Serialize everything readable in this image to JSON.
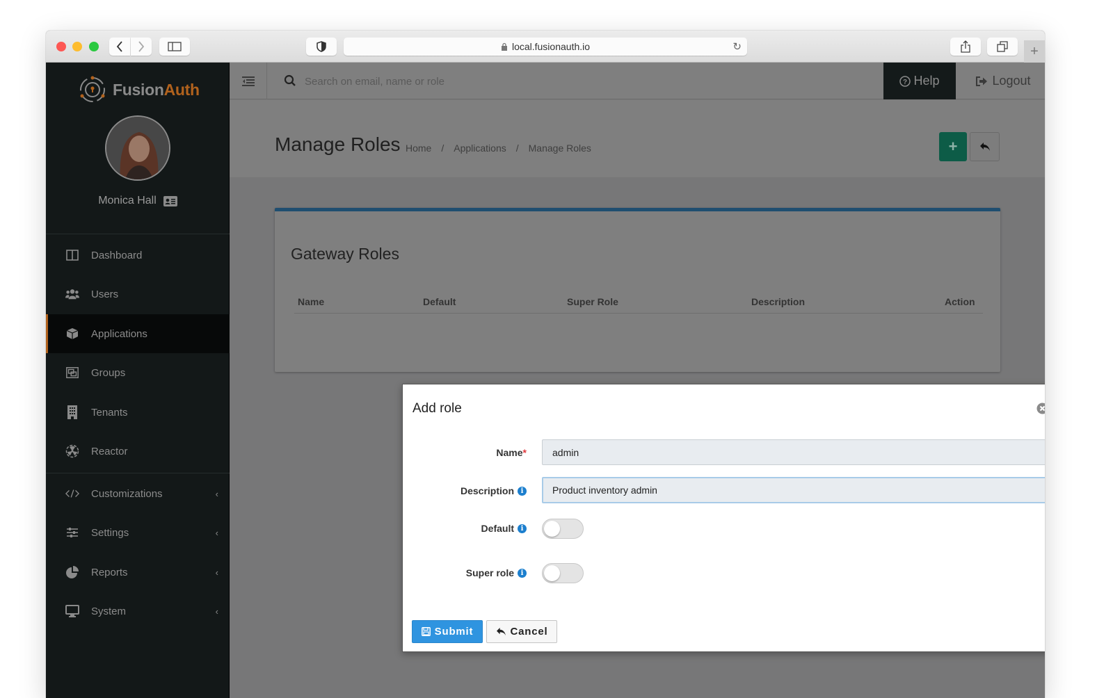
{
  "browser": {
    "url": "local.fusionauth.io",
    "new_tab_label": "+"
  },
  "sidebar": {
    "logo": {
      "part1": "Fusion",
      "part2": "Auth"
    },
    "user_name": "Monica Hall",
    "items": [
      {
        "label": "Dashboard",
        "icon": "dashboard-icon",
        "active": false,
        "expandable": false
      },
      {
        "label": "Users",
        "icon": "users-icon",
        "active": false,
        "expandable": false
      },
      {
        "label": "Applications",
        "icon": "cube-icon",
        "active": true,
        "expandable": false
      },
      {
        "label": "Groups",
        "icon": "groups-icon",
        "active": false,
        "expandable": false
      },
      {
        "label": "Tenants",
        "icon": "building-icon",
        "active": false,
        "expandable": false
      },
      {
        "label": "Reactor",
        "icon": "radiation-icon",
        "active": false,
        "expandable": false
      },
      {
        "label": "Customizations",
        "icon": "code-icon",
        "active": false,
        "expandable": true
      },
      {
        "label": "Settings",
        "icon": "sliders-icon",
        "active": false,
        "expandable": true
      },
      {
        "label": "Reports",
        "icon": "pie-chart-icon",
        "active": false,
        "expandable": true
      },
      {
        "label": "System",
        "icon": "desktop-icon",
        "active": false,
        "expandable": true
      }
    ]
  },
  "topbar": {
    "search_placeholder": "Search on email, name or role",
    "help_label": "Help",
    "logout_label": "Logout"
  },
  "page": {
    "title": "Manage Roles",
    "breadcrumb": [
      "Home",
      "/",
      "Applications",
      "/",
      "Manage Roles"
    ]
  },
  "panel": {
    "title": "Gateway Roles",
    "columns": [
      "Name",
      "Default",
      "Super Role",
      "Description",
      "Action"
    ]
  },
  "modal": {
    "title": "Add role",
    "fields": {
      "name": {
        "label": "Name",
        "required_mark": "*",
        "value": "admin"
      },
      "description": {
        "label": "Description",
        "value": "Product inventory admin"
      },
      "default": {
        "label": "Default",
        "checked": false
      },
      "super_role": {
        "label": "Super role",
        "checked": false
      }
    },
    "submit_label": "Submit",
    "cancel_label": "Cancel"
  },
  "colors": {
    "brand_orange": "#b1621d",
    "primary_blue": "#2f94e0",
    "add_green": "#0d5c47",
    "panel_accent": "#1f4e70",
    "required_red": "#e0393e",
    "info_blue": "#1c7fce"
  }
}
